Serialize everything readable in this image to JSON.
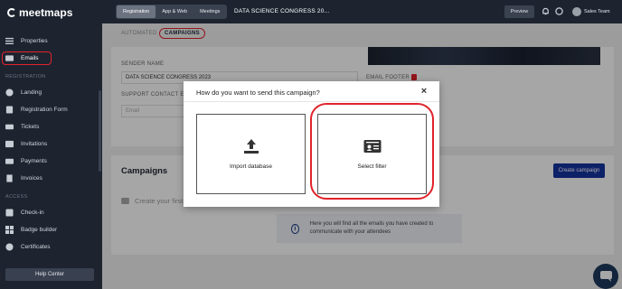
{
  "app": {
    "logo_text": "meetmaps"
  },
  "sidebar": {
    "items": [
      {
        "label": "Properties",
        "icon": "list-icon"
      },
      {
        "label": "Emails",
        "icon": "mail-icon",
        "active": true
      },
      {
        "label": "Landing",
        "icon": "globe-icon"
      },
      {
        "label": "Registration Form",
        "icon": "form-icon"
      },
      {
        "label": "Tickets",
        "icon": "ticket-icon"
      },
      {
        "label": "Invitations",
        "icon": "invitation-icon"
      },
      {
        "label": "Payments",
        "icon": "card-icon"
      },
      {
        "label": "Invoices",
        "icon": "invoice-icon"
      },
      {
        "label": "Check-in",
        "icon": "checkin-icon"
      },
      {
        "label": "Badge builder",
        "icon": "badge-icon"
      },
      {
        "label": "Certificates",
        "icon": "certificate-icon"
      }
    ],
    "sections": {
      "registration": "REGISTRATION",
      "access": "ACCESS"
    },
    "help_label": "Help Center"
  },
  "topbar": {
    "tabs": [
      "Registration",
      "App & Web",
      "Meetings"
    ],
    "event_title": "DATA SCIENCE CONGRESS 20...",
    "preview_label": "Preview",
    "user_name": "Sales Team"
  },
  "subtabs": [
    "AUTOMATED",
    "CAMPAIGNS"
  ],
  "settings": {
    "sender_name_label": "SENDER NAME",
    "sender_name_value": "DATA SCIENCE CONGRESS 2023",
    "support_label": "SUPPORT CONTACT EMAIL",
    "support_placeholder": "Email",
    "footer_label": "EMAIL FOOTER"
  },
  "campaigns": {
    "title": "Campaigns",
    "create_label": "Create campaign",
    "create_first": "Create your first",
    "info_text": "Here you will find all the emails you have created to communicate with your attendees"
  },
  "modal": {
    "title": "How do you want to send this campaign?",
    "options": [
      {
        "label": "Import database",
        "icon": "upload-icon"
      },
      {
        "label": "Select filter",
        "icon": "contact-card-icon"
      }
    ]
  },
  "colors": {
    "accent_red": "#e0232b",
    "primary_blue": "#1534a0",
    "sidebar_bg": "#1d2430"
  }
}
